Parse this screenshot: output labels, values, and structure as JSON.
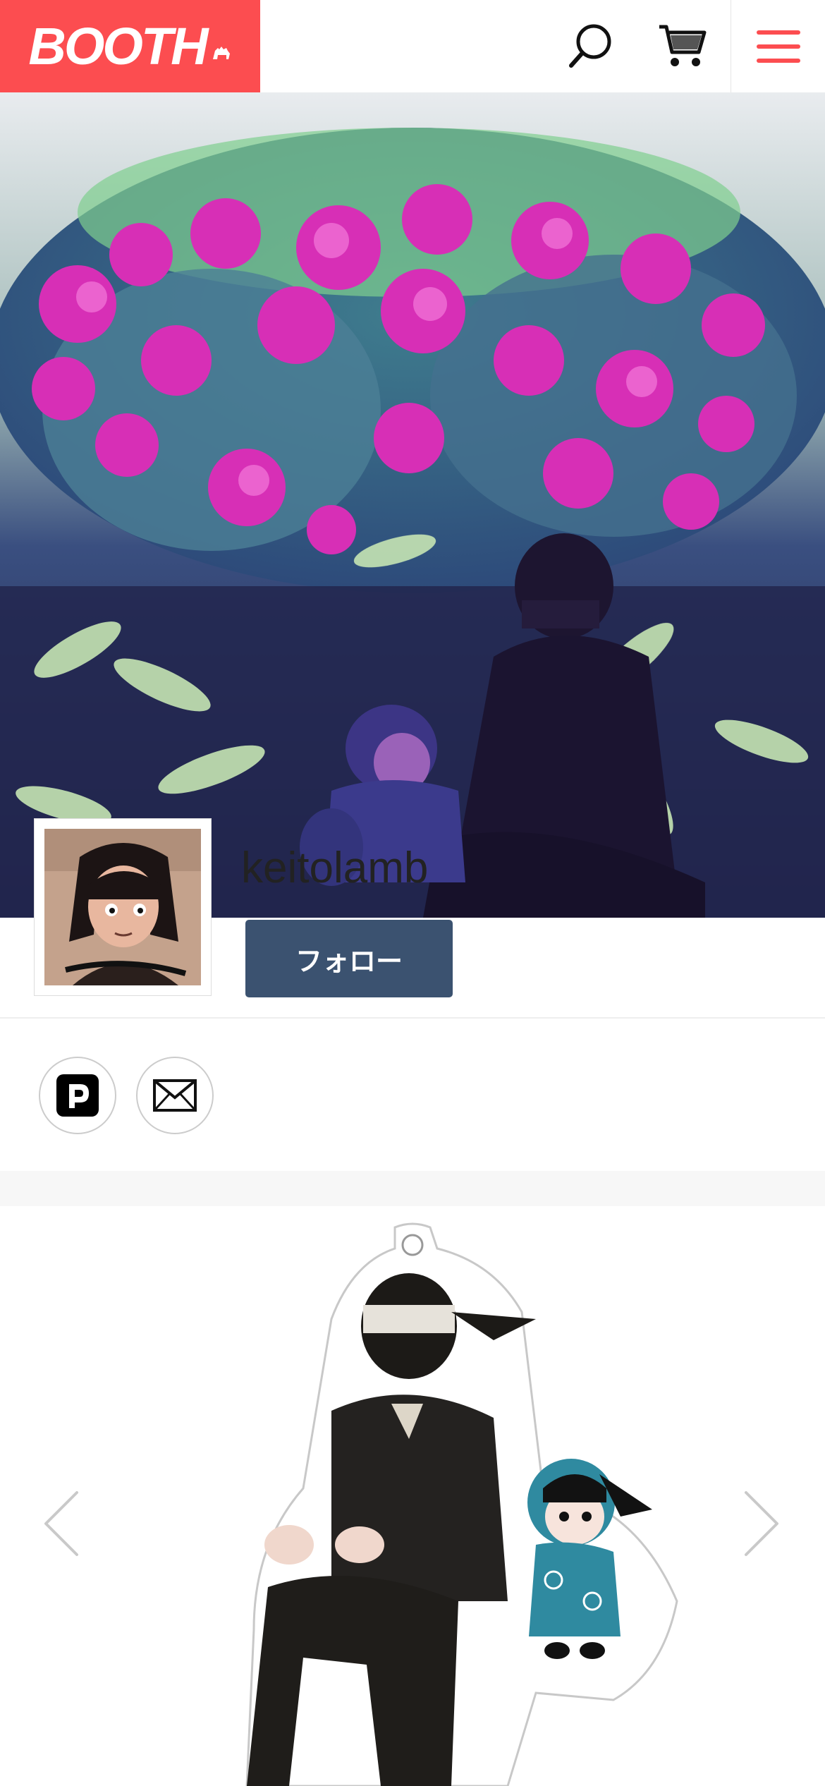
{
  "header": {
    "logo_text": "BOOTH",
    "brand_color": "#fc4d50",
    "icons": [
      "search-icon",
      "cart-icon",
      "hamburger-menu-icon"
    ]
  },
  "shop": {
    "name": "keitolamb",
    "follow_label": "フォロー",
    "follow_color": "#3b5270"
  },
  "social_links": [
    {
      "name": "pixiv",
      "icon": "pixiv-icon"
    },
    {
      "name": "mail",
      "icon": "mail-icon"
    }
  ],
  "carousel": {
    "prev_icon": "chevron-left-icon",
    "next_icon": "chevron-right-icon"
  }
}
